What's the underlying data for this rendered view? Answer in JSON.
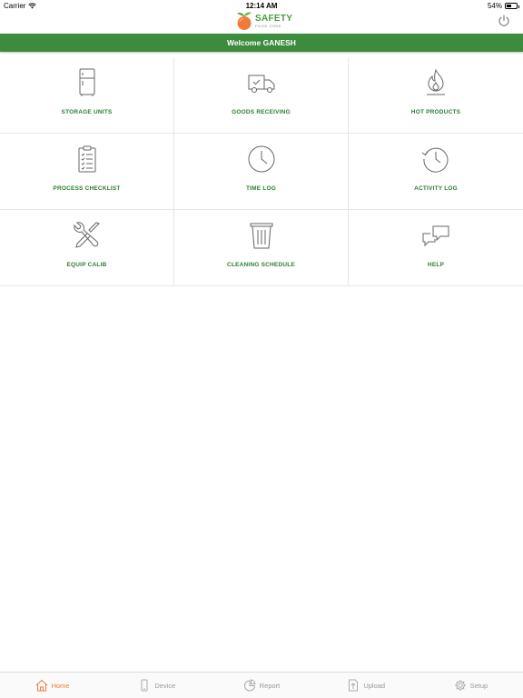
{
  "status": {
    "carrier": "Carrier",
    "time": "12:14 AM",
    "battery": "54%",
    "battery_level": 0.54
  },
  "header": {
    "logo_main": "SAFETY",
    "logo_sub": "FOOD ZONE"
  },
  "welcome": "Welcome GANESH",
  "tiles": [
    {
      "label": "STORAGE UNITS",
      "icon": "fridge-icon"
    },
    {
      "label": "GOODS RECEIVING",
      "icon": "delivery-truck-icon"
    },
    {
      "label": "HOT PRODUCTS",
      "icon": "flame-icon"
    },
    {
      "label": "PROCESS CHECKLIST",
      "icon": "clipboard-checklist-icon"
    },
    {
      "label": "TIME LOG",
      "icon": "clock-icon"
    },
    {
      "label": "ACTIVITY LOG",
      "icon": "history-clock-icon"
    },
    {
      "label": "EQUIP CALIB",
      "icon": "tools-icon"
    },
    {
      "label": "CLEANING SCHEDULE",
      "icon": "trash-bin-icon"
    },
    {
      "label": "HELP",
      "icon": "chat-bubbles-icon"
    }
  ],
  "tabs": [
    {
      "label": "Home",
      "icon": "home-icon",
      "active": true
    },
    {
      "label": "Device",
      "icon": "device-icon"
    },
    {
      "label": "Report",
      "icon": "pie-chart-icon"
    },
    {
      "label": "Upload",
      "icon": "upload-file-icon"
    },
    {
      "label": "Setup",
      "icon": "gear-icon"
    }
  ],
  "colors": {
    "brand_green": "#3d8b3d",
    "label_green": "#2e7d32",
    "accent_orange": "#f07a3a"
  }
}
